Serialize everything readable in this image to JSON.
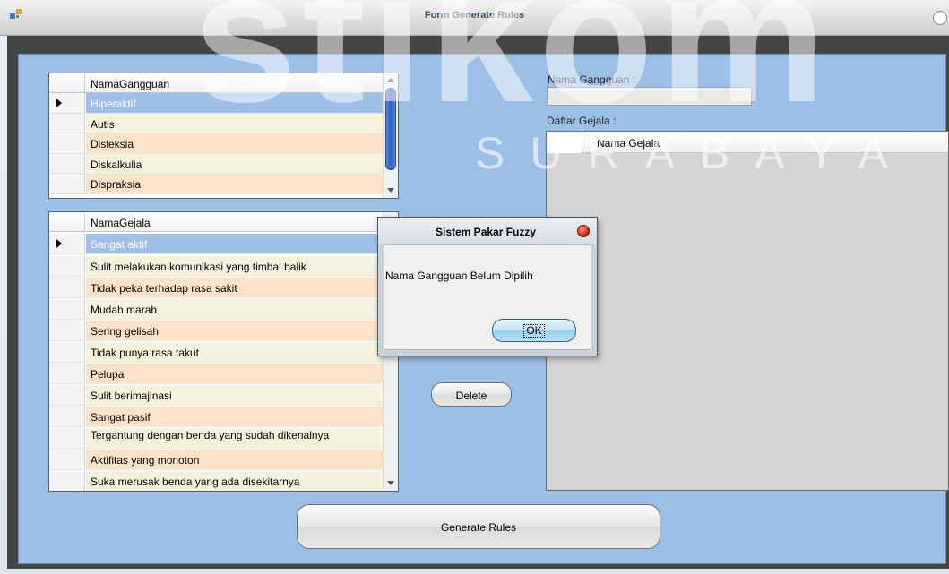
{
  "window": {
    "title": "Form Generate Rules"
  },
  "watermark": {
    "main": "stikom",
    "sub": "SURABAYA"
  },
  "gangguan_grid": {
    "header": "NamaGangguan",
    "rows": [
      "Hiperaktif",
      "Autis",
      "Disleksia",
      "Diskalkulia",
      "Dispraksia"
    ]
  },
  "gejala_grid": {
    "header": "NamaGejala",
    "rows": [
      "Sangat aktif",
      "Sulit melakukan komunikasi yang timbal balik",
      "Tidak peka terhadap rasa sakit",
      "Mudah marah",
      "Sering gelisah",
      "Tidak punya rasa takut",
      "Pelupa",
      "Sulit berimajinasi",
      "Sangat pasif",
      "Tergantung dengan benda yang sudah dikenalnya",
      "Aktifitas yang monoton",
      "Suka merusak benda yang ada disekitarnya"
    ]
  },
  "right_panel": {
    "nama_gangguan_label": "Nama Gangguan :",
    "nama_gangguan_value": "",
    "daftar_gejala_label": "Daftar Gejala :",
    "gejala_column": "Nama Gejala"
  },
  "buttons": {
    "delete": "Delete",
    "generate": "Generate Rules"
  },
  "dialog": {
    "title": "Sistem Pakar Fuzzy",
    "message": "Nama Gangguan Belum Dipilih",
    "ok": "OK"
  }
}
